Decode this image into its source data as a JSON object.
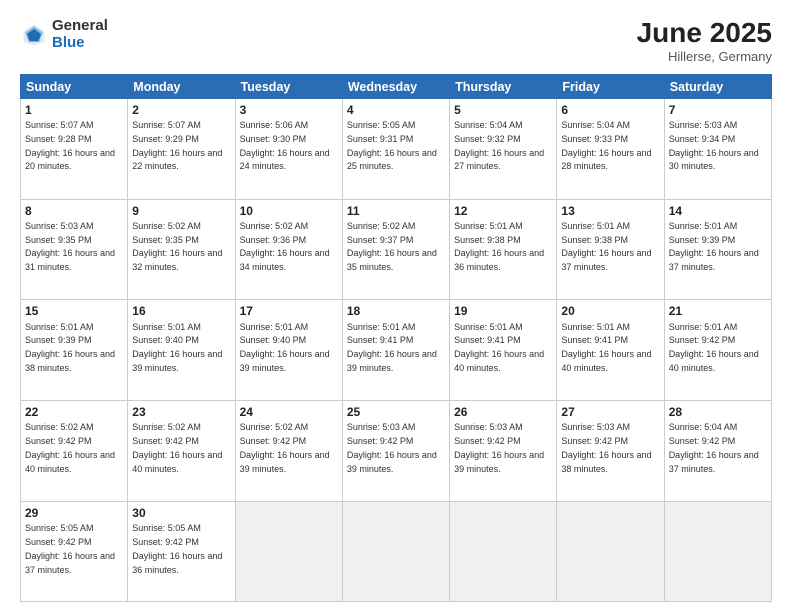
{
  "logo": {
    "general": "General",
    "blue": "Blue"
  },
  "header": {
    "month": "June 2025",
    "location": "Hillerse, Germany"
  },
  "weekdays": [
    "Sunday",
    "Monday",
    "Tuesday",
    "Wednesday",
    "Thursday",
    "Friday",
    "Saturday"
  ],
  "weeks": [
    [
      {
        "day": 1,
        "rise": "5:07 AM",
        "set": "9:28 PM",
        "daylight": "16 hours and 20 minutes."
      },
      {
        "day": 2,
        "rise": "5:07 AM",
        "set": "9:29 PM",
        "daylight": "16 hours and 22 minutes."
      },
      {
        "day": 3,
        "rise": "5:06 AM",
        "set": "9:30 PM",
        "daylight": "16 hours and 24 minutes."
      },
      {
        "day": 4,
        "rise": "5:05 AM",
        "set": "9:31 PM",
        "daylight": "16 hours and 25 minutes."
      },
      {
        "day": 5,
        "rise": "5:04 AM",
        "set": "9:32 PM",
        "daylight": "16 hours and 27 minutes."
      },
      {
        "day": 6,
        "rise": "5:04 AM",
        "set": "9:33 PM",
        "daylight": "16 hours and 28 minutes."
      },
      {
        "day": 7,
        "rise": "5:03 AM",
        "set": "9:34 PM",
        "daylight": "16 hours and 30 minutes."
      }
    ],
    [
      {
        "day": 8,
        "rise": "5:03 AM",
        "set": "9:35 PM",
        "daylight": "16 hours and 31 minutes."
      },
      {
        "day": 9,
        "rise": "5:02 AM",
        "set": "9:35 PM",
        "daylight": "16 hours and 32 minutes."
      },
      {
        "day": 10,
        "rise": "5:02 AM",
        "set": "9:36 PM",
        "daylight": "16 hours and 34 minutes."
      },
      {
        "day": 11,
        "rise": "5:02 AM",
        "set": "9:37 PM",
        "daylight": "16 hours and 35 minutes."
      },
      {
        "day": 12,
        "rise": "5:01 AM",
        "set": "9:38 PM",
        "daylight": "16 hours and 36 minutes."
      },
      {
        "day": 13,
        "rise": "5:01 AM",
        "set": "9:38 PM",
        "daylight": "16 hours and 37 minutes."
      },
      {
        "day": 14,
        "rise": "5:01 AM",
        "set": "9:39 PM",
        "daylight": "16 hours and 37 minutes."
      }
    ],
    [
      {
        "day": 15,
        "rise": "5:01 AM",
        "set": "9:39 PM",
        "daylight": "16 hours and 38 minutes."
      },
      {
        "day": 16,
        "rise": "5:01 AM",
        "set": "9:40 PM",
        "daylight": "16 hours and 39 minutes."
      },
      {
        "day": 17,
        "rise": "5:01 AM",
        "set": "9:40 PM",
        "daylight": "16 hours and 39 minutes."
      },
      {
        "day": 18,
        "rise": "5:01 AM",
        "set": "9:41 PM",
        "daylight": "16 hours and 39 minutes."
      },
      {
        "day": 19,
        "rise": "5:01 AM",
        "set": "9:41 PM",
        "daylight": "16 hours and 40 minutes."
      },
      {
        "day": 20,
        "rise": "5:01 AM",
        "set": "9:41 PM",
        "daylight": "16 hours and 40 minutes."
      },
      {
        "day": 21,
        "rise": "5:01 AM",
        "set": "9:42 PM",
        "daylight": "16 hours and 40 minutes."
      }
    ],
    [
      {
        "day": 22,
        "rise": "5:02 AM",
        "set": "9:42 PM",
        "daylight": "16 hours and 40 minutes."
      },
      {
        "day": 23,
        "rise": "5:02 AM",
        "set": "9:42 PM",
        "daylight": "16 hours and 40 minutes."
      },
      {
        "day": 24,
        "rise": "5:02 AM",
        "set": "9:42 PM",
        "daylight": "16 hours and 39 minutes."
      },
      {
        "day": 25,
        "rise": "5:03 AM",
        "set": "9:42 PM",
        "daylight": "16 hours and 39 minutes."
      },
      {
        "day": 26,
        "rise": "5:03 AM",
        "set": "9:42 PM",
        "daylight": "16 hours and 39 minutes."
      },
      {
        "day": 27,
        "rise": "5:03 AM",
        "set": "9:42 PM",
        "daylight": "16 hours and 38 minutes."
      },
      {
        "day": 28,
        "rise": "5:04 AM",
        "set": "9:42 PM",
        "daylight": "16 hours and 37 minutes."
      }
    ],
    [
      {
        "day": 29,
        "rise": "5:05 AM",
        "set": "9:42 PM",
        "daylight": "16 hours and 37 minutes."
      },
      {
        "day": 30,
        "rise": "5:05 AM",
        "set": "9:42 PM",
        "daylight": "16 hours and 36 minutes."
      },
      null,
      null,
      null,
      null,
      null
    ]
  ]
}
